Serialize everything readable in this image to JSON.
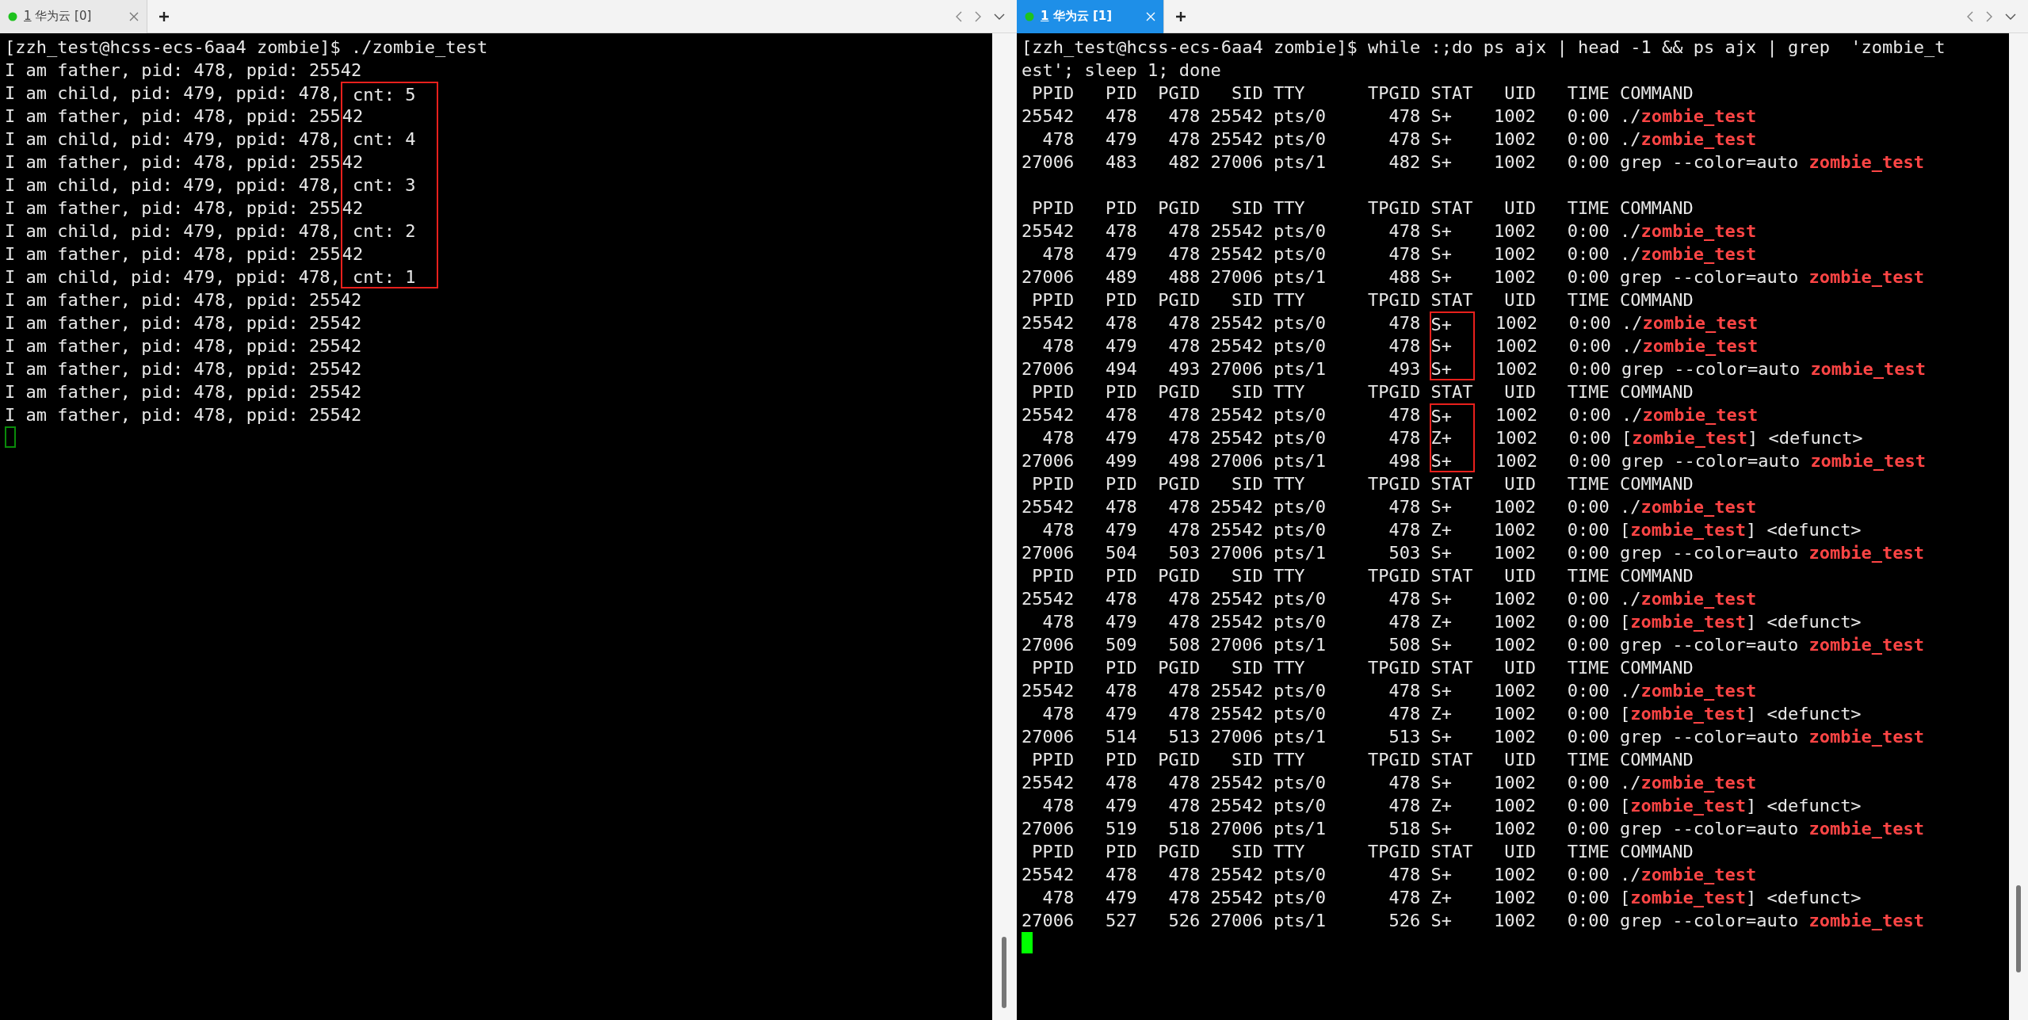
{
  "panes": [
    {
      "tab": {
        "number": "1",
        "label": "华为云 [0]",
        "selected": false
      },
      "lines": [
        {
          "kind": "text",
          "segments": [
            {
              "kind": "plain",
              "text": "[zzh_test@hcss-ecs-6aa4 zombie]$ ./zombie_test"
            }
          ]
        },
        {
          "kind": "text",
          "segments": [
            {
              "kind": "plain",
              "text": "I am father, pid: 478, ppid: 25542"
            }
          ]
        },
        {
          "kind": "text",
          "segments": [
            {
              "kind": "plain",
              "text": "I am child, pid: 479, ppid: 478,"
            },
            {
              "kind": "boxed",
              "text": " cnt: 5"
            }
          ]
        },
        {
          "kind": "text",
          "segments": [
            {
              "kind": "plain",
              "text": "I am father, pid: 478, ppid: 255"
            },
            {
              "kind": "boxed",
              "text": "42"
            }
          ]
        },
        {
          "kind": "text",
          "segments": [
            {
              "kind": "plain",
              "text": "I am child, pid: 479, ppid: 478,"
            },
            {
              "kind": "boxed",
              "text": " cnt: 4"
            }
          ]
        },
        {
          "kind": "text",
          "segments": [
            {
              "kind": "plain",
              "text": "I am father, pid: 478, ppid: 255"
            },
            {
              "kind": "boxed",
              "text": "42"
            }
          ]
        },
        {
          "kind": "text",
          "segments": [
            {
              "kind": "plain",
              "text": "I am child, pid: 479, ppid: 478,"
            },
            {
              "kind": "boxed",
              "text": " cnt: 3"
            }
          ]
        },
        {
          "kind": "text",
          "segments": [
            {
              "kind": "plain",
              "text": "I am father, pid: 478, ppid: 255"
            },
            {
              "kind": "boxed",
              "text": "42"
            }
          ]
        },
        {
          "kind": "text",
          "segments": [
            {
              "kind": "plain",
              "text": "I am child, pid: 479, ppid: 478,"
            },
            {
              "kind": "boxed",
              "text": " cnt: 2"
            }
          ]
        },
        {
          "kind": "text",
          "segments": [
            {
              "kind": "plain",
              "text": "I am father, pid: 478, ppid: 255"
            },
            {
              "kind": "boxed",
              "text": "42"
            }
          ]
        },
        {
          "kind": "text",
          "segments": [
            {
              "kind": "plain",
              "text": "I am child, pid: 479, ppid: 478,"
            },
            {
              "kind": "boxed",
              "text": " cnt: 1"
            }
          ]
        },
        {
          "kind": "text",
          "segments": [
            {
              "kind": "plain",
              "text": "I am father, pid: 478, ppid: 25542"
            }
          ]
        },
        {
          "kind": "text",
          "segments": [
            {
              "kind": "plain",
              "text": "I am father, pid: 478, ppid: 25542"
            }
          ]
        },
        {
          "kind": "text",
          "segments": [
            {
              "kind": "plain",
              "text": "I am father, pid: 478, ppid: 25542"
            }
          ]
        },
        {
          "kind": "text",
          "segments": [
            {
              "kind": "plain",
              "text": "I am father, pid: 478, ppid: 25542"
            }
          ]
        },
        {
          "kind": "text",
          "segments": [
            {
              "kind": "plain",
              "text": "I am father, pid: 478, ppid: 25542"
            }
          ]
        },
        {
          "kind": "text",
          "segments": [
            {
              "kind": "plain",
              "text": "I am father, pid: 478, ppid: 25542"
            }
          ]
        }
      ],
      "cursor": {
        "focused": false
      }
    },
    {
      "tab": {
        "number": "1",
        "label": "华为云 [1]",
        "selected": true
      },
      "lines": [
        {
          "kind": "text",
          "segments": [
            {
              "kind": "plain",
              "text": "[zzh_test@hcss-ecs-6aa4 zombie]$ while :;do ps ajx | head -1 && ps ajx | grep  'zombie_t"
            }
          ]
        },
        {
          "kind": "text",
          "segments": [
            {
              "kind": "plain",
              "text": "est'; sleep 1; done"
            }
          ]
        },
        {
          "kind": "text",
          "segments": [
            {
              "kind": "plain",
              "text": " PPID   PID  PGID   SID TTY      TPGID STAT   UID   TIME COMMAND"
            }
          ]
        },
        {
          "kind": "text",
          "segments": [
            {
              "kind": "plain",
              "text": "25542   478   478 25542 pts/0      478 S+    1002   0:00 ./"
            },
            {
              "kind": "match",
              "text": "zombie_test"
            }
          ]
        },
        {
          "kind": "text",
          "segments": [
            {
              "kind": "plain",
              "text": "  478   479   478 25542 pts/0      478 S+    1002   0:00 ./"
            },
            {
              "kind": "match",
              "text": "zombie_test"
            }
          ]
        },
        {
          "kind": "text",
          "segments": [
            {
              "kind": "plain",
              "text": "27006   483   482 27006 pts/1      482 S+    1002   0:00 grep --color=auto "
            },
            {
              "kind": "match",
              "text": "zombie_test"
            }
          ]
        },
        {
          "kind": "blank"
        },
        {
          "kind": "text",
          "segments": [
            {
              "kind": "plain",
              "text": " PPID   PID  PGID   SID TTY      TPGID STAT   UID   TIME COMMAND"
            }
          ]
        },
        {
          "kind": "text",
          "segments": [
            {
              "kind": "plain",
              "text": "25542   478   478 25542 pts/0      478 S+    1002   0:00 ./"
            },
            {
              "kind": "match",
              "text": "zombie_test"
            }
          ]
        },
        {
          "kind": "text",
          "segments": [
            {
              "kind": "plain",
              "text": "  478   479   478 25542 pts/0      478 S+    1002   0:00 ./"
            },
            {
              "kind": "match",
              "text": "zombie_test"
            }
          ]
        },
        {
          "kind": "text",
          "segments": [
            {
              "kind": "plain",
              "text": "27006   489   488 27006 pts/1      488 S+    1002   0:00 grep --color=auto "
            },
            {
              "kind": "match",
              "text": "zombie_test"
            }
          ]
        },
        {
          "kind": "text",
          "segments": [
            {
              "kind": "plain",
              "text": " PPID   PID  PGID   SID TTY      TPGID STAT   UID   TIME COMMAND"
            }
          ]
        },
        {
          "kind": "text",
          "segments": [
            {
              "kind": "plain",
              "text": "25542   478   478 25542 pts/0      478 "
            },
            {
              "kind": "boxed",
              "text": "S+"
            },
            {
              "kind": "plain",
              "text": "  1002   0:00 ./"
            },
            {
              "kind": "match",
              "text": "zombie_test"
            }
          ]
        },
        {
          "kind": "text",
          "segments": [
            {
              "kind": "plain",
              "text": "  478   479   478 25542 pts/0      478 "
            },
            {
              "kind": "boxed",
              "text": "S+"
            },
            {
              "kind": "plain",
              "text": "  1002   0:00 ./"
            },
            {
              "kind": "match",
              "text": "zombie_test"
            }
          ]
        },
        {
          "kind": "text",
          "segments": [
            {
              "kind": "plain",
              "text": "27006   494   493 27006 pts/1      493 "
            },
            {
              "kind": "boxed",
              "text": "S+"
            },
            {
              "kind": "plain",
              "text": "  1002   0:00 grep --color=auto "
            },
            {
              "kind": "match",
              "text": "zombie_test"
            }
          ]
        },
        {
          "kind": "text",
          "segments": [
            {
              "kind": "plain",
              "text": " PPID   PID  PGID   SID TTY      TPGID STAT   UID   TIME COMMAND"
            }
          ]
        },
        {
          "kind": "text",
          "segments": [
            {
              "kind": "plain",
              "text": "25542   478   478 25542 pts/0      478 "
            },
            {
              "kind": "boxed",
              "text": "S+"
            },
            {
              "kind": "plain",
              "text": "  1002   0:00 ./"
            },
            {
              "kind": "match",
              "text": "zombie_test"
            }
          ]
        },
        {
          "kind": "text",
          "segments": [
            {
              "kind": "plain",
              "text": "  478   479   478 25542 pts/0      478 "
            },
            {
              "kind": "boxed",
              "text": "Z+"
            },
            {
              "kind": "plain",
              "text": "  1002   0:00 ["
            },
            {
              "kind": "match",
              "text": "zombie_test"
            },
            {
              "kind": "plain",
              "text": "] <defunct>"
            }
          ]
        },
        {
          "kind": "text",
          "segments": [
            {
              "kind": "plain",
              "text": "27006   499   498 27006 pts/1      498 "
            },
            {
              "kind": "boxed",
              "text": "S+"
            },
            {
              "kind": "plain",
              "text": "  1002   0:00 grep --color=auto "
            },
            {
              "kind": "match",
              "text": "zombie_test"
            }
          ]
        },
        {
          "kind": "text",
          "segments": [
            {
              "kind": "plain",
              "text": " PPID   PID  PGID   SID TTY      TPGID STAT   UID   TIME COMMAND"
            }
          ]
        },
        {
          "kind": "text",
          "segments": [
            {
              "kind": "plain",
              "text": "25542   478   478 25542 pts/0      478 S+    1002   0:00 ./"
            },
            {
              "kind": "match",
              "text": "zombie_test"
            }
          ]
        },
        {
          "kind": "text",
          "segments": [
            {
              "kind": "plain",
              "text": "  478   479   478 25542 pts/0      478 Z+    1002   0:00 ["
            },
            {
              "kind": "match",
              "text": "zombie_test"
            },
            {
              "kind": "plain",
              "text": "] <defunct>"
            }
          ]
        },
        {
          "kind": "text",
          "segments": [
            {
              "kind": "plain",
              "text": "27006   504   503 27006 pts/1      503 S+    1002   0:00 grep --color=auto "
            },
            {
              "kind": "match",
              "text": "zombie_test"
            }
          ]
        },
        {
          "kind": "text",
          "segments": [
            {
              "kind": "plain",
              "text": " PPID   PID  PGID   SID TTY      TPGID STAT   UID   TIME COMMAND"
            }
          ]
        },
        {
          "kind": "text",
          "segments": [
            {
              "kind": "plain",
              "text": "25542   478   478 25542 pts/0      478 S+    1002   0:00 ./"
            },
            {
              "kind": "match",
              "text": "zombie_test"
            }
          ]
        },
        {
          "kind": "text",
          "segments": [
            {
              "kind": "plain",
              "text": "  478   479   478 25542 pts/0      478 Z+    1002   0:00 ["
            },
            {
              "kind": "match",
              "text": "zombie_test"
            },
            {
              "kind": "plain",
              "text": "] <defunct>"
            }
          ]
        },
        {
          "kind": "text",
          "segments": [
            {
              "kind": "plain",
              "text": "27006   509   508 27006 pts/1      508 S+    1002   0:00 grep --color=auto "
            },
            {
              "kind": "match",
              "text": "zombie_test"
            }
          ]
        },
        {
          "kind": "text",
          "segments": [
            {
              "kind": "plain",
              "text": " PPID   PID  PGID   SID TTY      TPGID STAT   UID   TIME COMMAND"
            }
          ]
        },
        {
          "kind": "text",
          "segments": [
            {
              "kind": "plain",
              "text": "25542   478   478 25542 pts/0      478 S+    1002   0:00 ./"
            },
            {
              "kind": "match",
              "text": "zombie_test"
            }
          ]
        },
        {
          "kind": "text",
          "segments": [
            {
              "kind": "plain",
              "text": "  478   479   478 25542 pts/0      478 Z+    1002   0:00 ["
            },
            {
              "kind": "match",
              "text": "zombie_test"
            },
            {
              "kind": "plain",
              "text": "] <defunct>"
            }
          ]
        },
        {
          "kind": "text",
          "segments": [
            {
              "kind": "plain",
              "text": "27006   514   513 27006 pts/1      513 S+    1002   0:00 grep --color=auto "
            },
            {
              "kind": "match",
              "text": "zombie_test"
            }
          ]
        },
        {
          "kind": "text",
          "segments": [
            {
              "kind": "plain",
              "text": " PPID   PID  PGID   SID TTY      TPGID STAT   UID   TIME COMMAND"
            }
          ]
        },
        {
          "kind": "text",
          "segments": [
            {
              "kind": "plain",
              "text": "25542   478   478 25542 pts/0      478 S+    1002   0:00 ./"
            },
            {
              "kind": "match",
              "text": "zombie_test"
            }
          ]
        },
        {
          "kind": "text",
          "segments": [
            {
              "kind": "plain",
              "text": "  478   479   478 25542 pts/0      478 Z+    1002   0:00 ["
            },
            {
              "kind": "match",
              "text": "zombie_test"
            },
            {
              "kind": "plain",
              "text": "] <defunct>"
            }
          ]
        },
        {
          "kind": "text",
          "segments": [
            {
              "kind": "plain",
              "text": "27006   519   518 27006 pts/1      518 S+    1002   0:00 grep --color=auto "
            },
            {
              "kind": "match",
              "text": "zombie_test"
            }
          ]
        },
        {
          "kind": "text",
          "segments": [
            {
              "kind": "plain",
              "text": " PPID   PID  PGID   SID TTY      TPGID STAT   UID   TIME COMMAND"
            }
          ]
        },
        {
          "kind": "text",
          "segments": [
            {
              "kind": "plain",
              "text": "25542   478   478 25542 pts/0      478 S+    1002   0:00 ./"
            },
            {
              "kind": "match",
              "text": "zombie_test"
            }
          ]
        },
        {
          "kind": "text",
          "segments": [
            {
              "kind": "plain",
              "text": "  478   479   478 25542 pts/0      478 Z+    1002   0:00 ["
            },
            {
              "kind": "match",
              "text": "zombie_test"
            },
            {
              "kind": "plain",
              "text": "] <defunct>"
            }
          ]
        },
        {
          "kind": "text",
          "segments": [
            {
              "kind": "plain",
              "text": "27006   527   526 27006 pts/1      526 S+    1002   0:00 grep --color=auto "
            },
            {
              "kind": "match",
              "text": "zombie_test"
            }
          ]
        }
      ],
      "cursor": {
        "focused": true
      }
    }
  ]
}
